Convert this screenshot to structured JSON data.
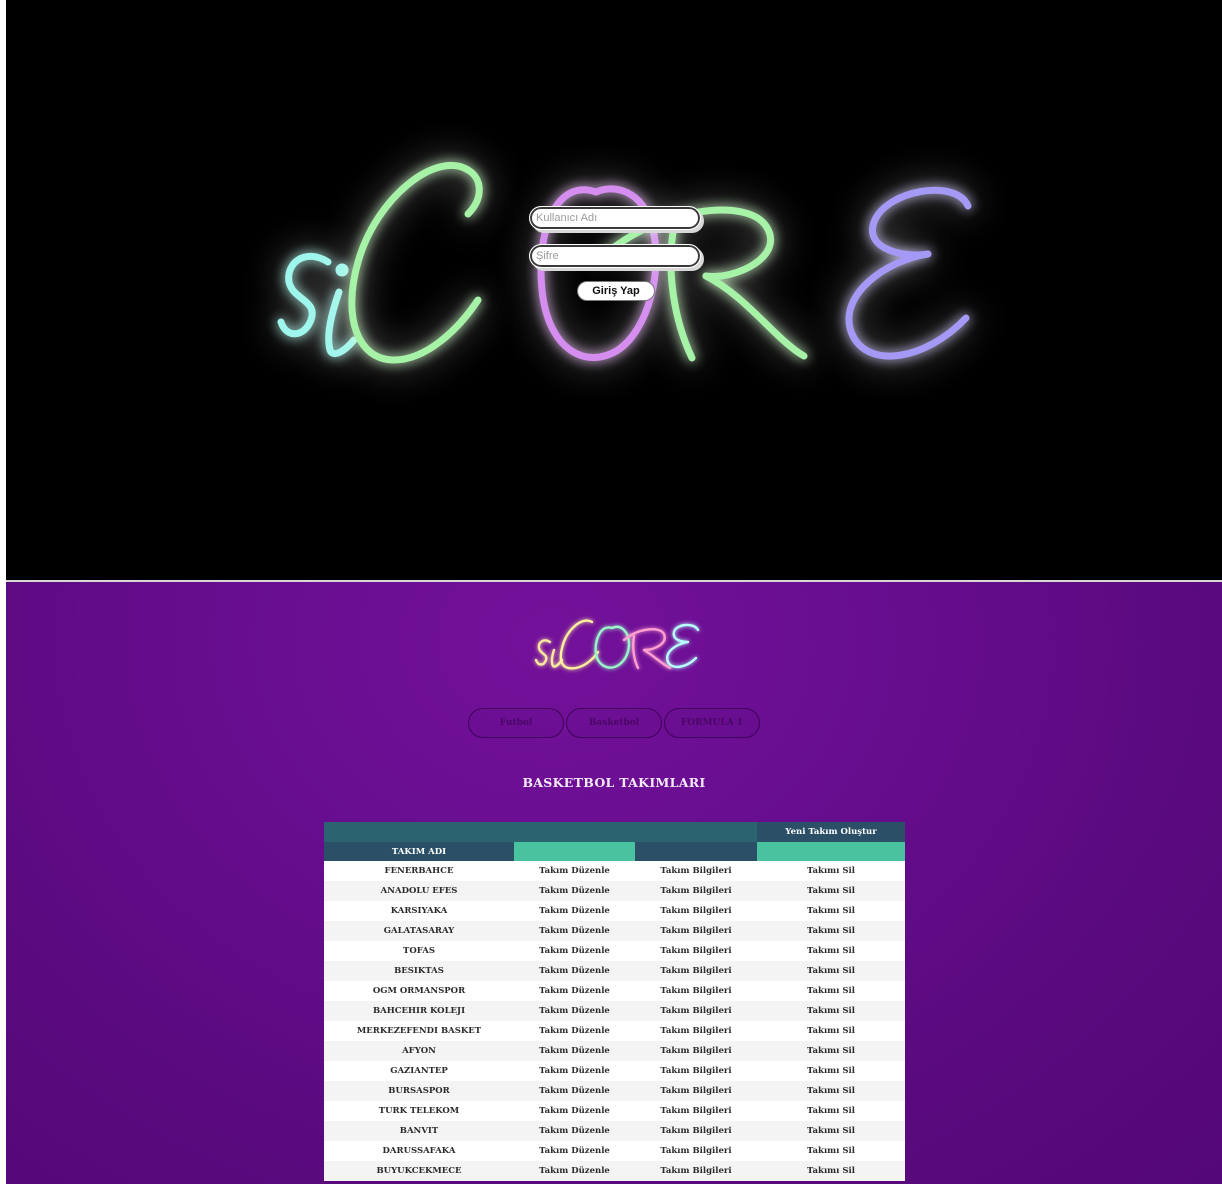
{
  "login": {
    "brand_name": "siCORE",
    "username_placeholder": "Kullanıcı Adı",
    "password_placeholder": "Şifre",
    "login_button": "Giriş Yap",
    "colors": {
      "background": "#000000",
      "si": "#9ff6ec",
      "c": "#a6f3a8",
      "o": "#d58df0",
      "r": "#a6f3a8",
      "e": "#a49af5"
    }
  },
  "dashboard": {
    "brand_name": "siCORE",
    "tabs": [
      {
        "label": "Futbol"
      },
      {
        "label": "Basketbol"
      },
      {
        "label": "FORMULA 1"
      }
    ],
    "section_title": "BASKETBOL TAKIMLARI",
    "create_team_label": "Yeni Takım Oluştur",
    "table_header": {
      "team_name": "TAKIM ADI"
    },
    "actions": {
      "edit": "Takım Düzenle",
      "info": "Takım Bilgileri",
      "delete": "Takımı Sil"
    },
    "teams": [
      "FENERBAHCE",
      "ANADOLU EFES",
      "KARSIYAKA",
      "GALATASARAY",
      "TOFAS",
      "BESIKTAS",
      "OGM ORMANSPOR",
      "BAHCEHIR KOLEJI",
      "MERKEZEFENDI BASKET",
      "AFYON",
      "GAZIANTEP",
      "BURSASPOR",
      "TURK TELEKOM",
      "BANVIT",
      "DARUSSAFAKA",
      "BUYUKCEKMECE"
    ],
    "colors": {
      "background": "#670d8f",
      "table_top": "#2b6370",
      "table_header": "#2b4f66",
      "table_accent": "#49c2a0"
    }
  }
}
